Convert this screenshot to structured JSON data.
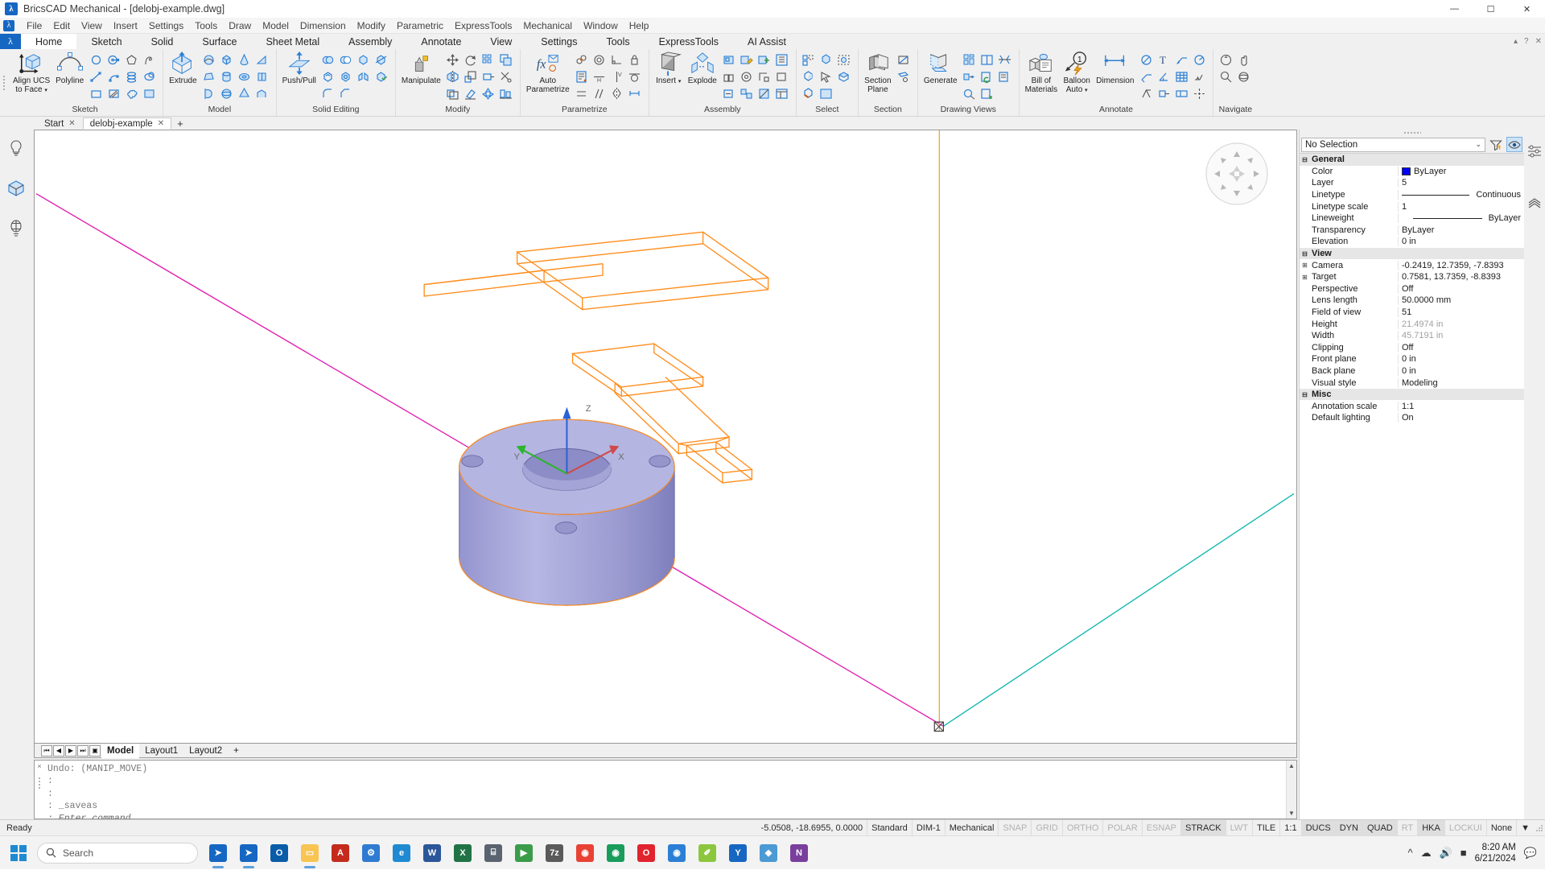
{
  "window": {
    "title": "BricsCAD Mechanical - [delobj-example.dwg]",
    "app_icon": "bricscad-logo-icon",
    "minimize": "—",
    "maximize": "☐",
    "close": "✕"
  },
  "menubar": {
    "items": [
      "File",
      "Edit",
      "View",
      "Insert",
      "Settings",
      "Tools",
      "Draw",
      "Model",
      "Dimension",
      "Modify",
      "Parametric",
      "ExpressTools",
      "Mechanical",
      "Window",
      "Help"
    ]
  },
  "ribbon_tabs": {
    "items": [
      "Home",
      "Sketch",
      "Solid",
      "Surface",
      "Sheet Metal",
      "Assembly",
      "Annotate",
      "View",
      "Settings",
      "Tools",
      "ExpressTools",
      "AI Assist"
    ],
    "active": "Home"
  },
  "ribbon": {
    "panels": [
      {
        "label": "Sketch",
        "big": [
          {
            "caption": "Align UCS\nto Face",
            "icon": "align-ucs-to-face-icon",
            "dropdown": true
          },
          {
            "caption": "Polyline",
            "icon": "polyline-icon",
            "dropdown": false
          }
        ],
        "icons": [
          "circle-icon",
          "circle-center-icon",
          "polygon-icon",
          "spline-icon",
          "line-icon",
          "arc-icon",
          "helix-icon",
          "ellipse-icon",
          "rectangle-icon",
          "hatch-icon",
          "revision-cloud-icon",
          "region-icon"
        ]
      },
      {
        "label": "Model",
        "big": [
          {
            "caption": "Extrude",
            "icon": "extrude-icon",
            "dropdown": false
          }
        ],
        "icons": [
          "sweep-icon",
          "box-icon",
          "cone-icon",
          "wedge-icon",
          "loft-icon",
          "cylinder-icon",
          "torus-icon",
          "prism-icon",
          "revolve-icon",
          "sphere-icon",
          "pyramid-icon",
          "polysolid-icon"
        ]
      },
      {
        "label": "Solid Editing",
        "big": [
          {
            "caption": "Push/Pull",
            "icon": "push-pull-icon",
            "dropdown": false
          }
        ],
        "icons": [
          "union-icon",
          "subtract-icon",
          "intersect-icon",
          "slice-icon",
          "shell-icon",
          "imprint-icon",
          "separate-icon",
          "check-solid-icon",
          "fillet-edge-icon",
          "chamfer-edge-icon"
        ]
      },
      {
        "label": "Modify",
        "big": [
          {
            "caption": "Manipulate",
            "icon": "manipulate-icon",
            "dropdown": false
          }
        ],
        "icons": [
          "move-icon",
          "rotate-icon",
          "array-icon",
          "copy-icon",
          "mirror-icon",
          "scale-icon",
          "stretch-icon",
          "trim-icon",
          "offset-icon",
          "erase-icon",
          "explode-modify-icon",
          "align-icon"
        ]
      },
      {
        "label": "Parametrize",
        "big": [
          {
            "caption": "Auto\nParametrize",
            "icon": "auto-parametrize-icon",
            "dropdown": false
          }
        ],
        "icons": [
          "coincident-icon",
          "concentric-icon",
          "perpendicular-icon",
          "fix-constraint-icon",
          "parameters-manager-icon",
          "horizontal-constraint-icon",
          "vertical-constraint-icon",
          "tangent-icon",
          "equal-icon",
          "parallel-icon",
          "symmetric-icon",
          "dim-constraint-icon"
        ]
      },
      {
        "label": "Assembly",
        "big": [
          {
            "caption": "Insert",
            "icon": "insert-component-icon",
            "dropdown": true
          },
          {
            "caption": "Explode",
            "icon": "explode-icon",
            "dropdown": false
          }
        ],
        "icons": [
          "make-component-icon",
          "edit-component-icon",
          "new-component-icon",
          "mech-browser-icon",
          "constraint-insert-icon",
          "constraint-concentric-icon",
          "constraint-fix-icon",
          "mech-hide-icon",
          "mech-show-icon",
          "rigid-set-icon",
          "local-sections-icon",
          "bom-assembly-icon"
        ]
      },
      {
        "label": "Select",
        "big": [],
        "icons": [
          "select-similar-icon",
          "select-entity-icon",
          "select-by-type-icon",
          "select-subentity-icon",
          "quick-select-icon",
          "select-faces-icon",
          "select-edges-icon",
          "select-all-icon"
        ]
      },
      {
        "label": "Section",
        "big": [
          {
            "caption": "Section\nPlane",
            "icon": "section-plane-icon",
            "dropdown": false
          }
        ],
        "icons": [
          "section-view-icon",
          "section-settings-icon"
        ]
      },
      {
        "label": "Drawing Views",
        "big": [
          {
            "caption": "Generate",
            "icon": "generate-view-icon",
            "dropdown": false
          }
        ],
        "icons": [
          "base-view-icon",
          "view-layout-icon",
          "break-view-icon",
          "projected-view-icon",
          "update-view-icon",
          "section-view2-icon",
          "detail-view-icon",
          "export-view-icon"
        ]
      },
      {
        "label": "Annotate",
        "big": [
          {
            "caption": "Bill of\nMaterials",
            "icon": "bill-of-materials-icon",
            "dropdown": false
          },
          {
            "caption": "Balloon\nAuto",
            "icon": "balloon-auto-icon",
            "dropdown": true
          },
          {
            "caption": "Dimension",
            "icon": "dimension-icon",
            "dropdown": false
          }
        ],
        "icons": [
          "diameter-dim-icon",
          "text-icon",
          "leader-icon",
          "radius-dim-icon",
          "multileader-icon",
          "angular-dim-icon",
          "table-icon",
          "welding-symbol-icon",
          "surface-finish-icon",
          "datum-icon",
          "tolerance-icon",
          "centerline-icon"
        ]
      },
      {
        "label": "Navigate",
        "big": [],
        "icons": [
          "look-from-icon",
          "pan-icon",
          "zoom-icon",
          "orbit-icon"
        ]
      }
    ]
  },
  "doc_tabs": {
    "items": [
      {
        "label": "Start",
        "closable": true,
        "active": false
      },
      {
        "label": "delobj-example",
        "closable": true,
        "active": true
      }
    ],
    "add_label": "+"
  },
  "left_toolbar": {
    "items": [
      {
        "name": "tip-of-the-day-icon"
      },
      {
        "name": "model-browser-icon"
      },
      {
        "name": "render-icon"
      }
    ]
  },
  "canvas": {
    "ucs_labels": {
      "x": "X",
      "y": "Y",
      "z": "Z"
    },
    "navigation_widget": "look-from-widget",
    "colors": {
      "magenta_line": "#e01bb0",
      "orange_geometry": "#ff8c1a",
      "cyan_line": "#10b6b0",
      "solid_fill": "#b3b3e0",
      "solid_shade": "#8a8ac4",
      "axis_x": "#d04a4a",
      "axis_y": "#2db52d",
      "axis_z": "#2a62d8"
    }
  },
  "model_tabs": {
    "nav": [
      "⏮",
      "◀",
      "▶",
      "⏭",
      "▣"
    ],
    "items": [
      "Model",
      "Layout1",
      "Layout2"
    ],
    "active": "Model",
    "add_label": "+"
  },
  "properties": {
    "selector": {
      "value": "No Selection",
      "chevron": "⌄"
    },
    "header_icons": [
      {
        "name": "filter-selection-icon",
        "active": false
      },
      {
        "name": "quick-select-eye-icon",
        "active": true
      }
    ],
    "groups": [
      {
        "name": "General",
        "expander": "⊟",
        "rows": [
          {
            "label": "Color",
            "value": "ByLayer",
            "type": "color",
            "swatch": "#0000ff"
          },
          {
            "label": "Layer",
            "value": "5",
            "type": "text"
          },
          {
            "label": "Linetype",
            "value": "Continuous",
            "type": "line"
          },
          {
            "label": "Linetype scale",
            "value": "1",
            "type": "text"
          },
          {
            "label": "Lineweight",
            "value": "ByLayer",
            "type": "line"
          },
          {
            "label": "Transparency",
            "value": "ByLayer",
            "type": "text"
          },
          {
            "label": "Elevation",
            "value": "0 in",
            "type": "text"
          }
        ]
      },
      {
        "name": "View",
        "expander": "⊟",
        "rows": [
          {
            "label": "Camera",
            "value": "-0.2419, 12.7359, -7.8393",
            "type": "text",
            "expandable": true
          },
          {
            "label": "Target",
            "value": "0.7581, 13.7359, -8.8393",
            "type": "text",
            "expandable": true
          },
          {
            "label": "Perspective",
            "value": "Off",
            "type": "text"
          },
          {
            "label": "Lens length",
            "value": "50.0000 mm",
            "type": "text"
          },
          {
            "label": "Field of view",
            "value": "51",
            "type": "text"
          },
          {
            "label": "Height",
            "value": "21.4974 in",
            "type": "text",
            "dim": true
          },
          {
            "label": "Width",
            "value": "45.7191 in",
            "type": "text",
            "dim": true
          },
          {
            "label": "Clipping",
            "value": "Off",
            "type": "text"
          },
          {
            "label": "Front plane",
            "value": "0 in",
            "type": "text"
          },
          {
            "label": "Back plane",
            "value": "0 in",
            "type": "text"
          },
          {
            "label": "Visual style",
            "value": "Modeling",
            "type": "text"
          }
        ]
      },
      {
        "name": "Misc",
        "expander": "⊟",
        "rows": [
          {
            "label": "Annotation scale",
            "value": "1:1",
            "type": "text"
          },
          {
            "label": "Default lighting",
            "value": "On",
            "type": "text"
          }
        ]
      }
    ],
    "side_icons": [
      {
        "name": "properties-settings-icon"
      },
      {
        "name": "layers-icon"
      }
    ]
  },
  "command_line": {
    "lines": [
      "Undo: (MANIP_MOVE)",
      ":",
      ":",
      ": _saveas"
    ],
    "prompt": ": Enter command",
    "close_label": "×"
  },
  "status_bar": {
    "ready": "Ready",
    "coordinates": "-5.0508, -18.6955, 0.0000",
    "items": [
      {
        "label": "Standard",
        "state": "normal"
      },
      {
        "label": "DIM-1",
        "state": "normal"
      },
      {
        "label": "Mechanical",
        "state": "normal"
      },
      {
        "label": "SNAP",
        "state": "off"
      },
      {
        "label": "GRID",
        "state": "off"
      },
      {
        "label": "ORTHO",
        "state": "off"
      },
      {
        "label": "POLAR",
        "state": "off"
      },
      {
        "label": "ESNAP",
        "state": "off"
      },
      {
        "label": "STRACK",
        "state": "on"
      },
      {
        "label": "LWT",
        "state": "off"
      },
      {
        "label": "TILE",
        "state": "normal"
      },
      {
        "label": "1:1",
        "state": "normal"
      },
      {
        "label": "DUCS",
        "state": "on"
      },
      {
        "label": "DYN",
        "state": "on"
      },
      {
        "label": "QUAD",
        "state": "on"
      },
      {
        "label": "RT",
        "state": "off"
      },
      {
        "label": "HKA",
        "state": "on"
      },
      {
        "label": "LOCKUI",
        "state": "off"
      },
      {
        "label": "None",
        "state": "normal"
      }
    ],
    "dropdown": "▼"
  },
  "taskbar": {
    "start_icon": "windows-start-icon",
    "search_placeholder": "Search",
    "search_icon": "search-icon",
    "apps": [
      {
        "name": "bricscad-taskbar-icon",
        "glyph": "➤",
        "color": "#1667c2",
        "running": true
      },
      {
        "name": "bricscad-mechanical-taskbar-icon",
        "glyph": "➤",
        "color": "#1667c2",
        "running": true
      },
      {
        "name": "outlook-icon",
        "glyph": "O",
        "color": "#0a5ca8",
        "running": false
      },
      {
        "name": "file-explorer-icon",
        "glyph": "▭",
        "color": "#f8c452",
        "running": true
      },
      {
        "name": "acrobat-reader-icon",
        "glyph": "A",
        "color": "#c42b1c",
        "running": false
      },
      {
        "name": "settings-icon",
        "glyph": "⚙",
        "color": "#2f7bd2",
        "running": false
      },
      {
        "name": "edge-icon",
        "glyph": "e",
        "color": "#1f8ad2",
        "running": false
      },
      {
        "name": "word-icon",
        "glyph": "W",
        "color": "#2b579a",
        "running": false
      },
      {
        "name": "excel-icon",
        "glyph": "X",
        "color": "#217346",
        "running": false
      },
      {
        "name": "calculator-icon",
        "glyph": "⌸",
        "color": "#5a6470",
        "running": false
      },
      {
        "name": "media-player-icon",
        "glyph": "▶",
        "color": "#3a9c4a",
        "running": false
      },
      {
        "name": "7zip-icon",
        "glyph": "7z",
        "color": "#5a5a5a",
        "running": false
      },
      {
        "name": "chrome-icon",
        "glyph": "◉",
        "color": "#e84234",
        "running": false
      },
      {
        "name": "chrome-canary-icon",
        "glyph": "◉",
        "color": "#1a9c5b",
        "running": false
      },
      {
        "name": "opera-icon",
        "glyph": "O",
        "color": "#e0232e",
        "running": false
      },
      {
        "name": "firefox-icon",
        "glyph": "◉",
        "color": "#2b7fd4",
        "running": false
      },
      {
        "name": "notes-icon",
        "glyph": "✐",
        "color": "#8cc63f",
        "running": false
      },
      {
        "name": "yammer-icon",
        "glyph": "Y",
        "color": "#1667c2",
        "running": false
      },
      {
        "name": "defender-icon",
        "glyph": "◆",
        "color": "#4c9ad4",
        "running": false
      },
      {
        "name": "onenote-icon",
        "glyph": "N",
        "color": "#7a3f9d",
        "running": false
      }
    ],
    "tray": [
      {
        "name": "show-hidden-icons-icon",
        "glyph": "⌃"
      },
      {
        "name": "onedrive-icon",
        "glyph": "☁"
      },
      {
        "name": "volume-icon",
        "glyph": "🔊"
      },
      {
        "name": "battery-icon",
        "glyph": "▬"
      }
    ],
    "clock": {
      "time": "8:20 AM",
      "date": "6/21/2024"
    },
    "notification_icon": "notification-icon"
  }
}
